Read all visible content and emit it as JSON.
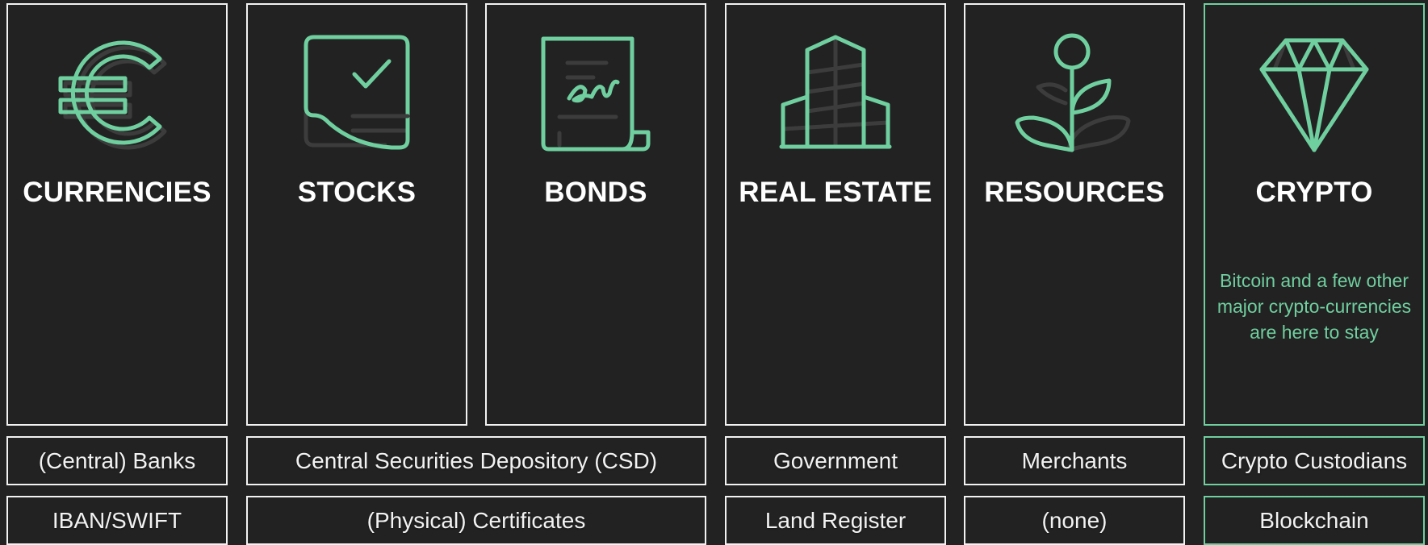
{
  "colors": {
    "background": "#222222",
    "border": "#f2f2f2",
    "accent": "#6fcf9f",
    "icon_shadow": "#3c3c3c"
  },
  "cards": [
    {
      "title": "CURRENCIES",
      "icon": "euro-icon"
    },
    {
      "title": "STOCKS",
      "icon": "stock-certificate-icon"
    },
    {
      "title": "BONDS",
      "icon": "signed-document-icon"
    },
    {
      "title": "REAL ESTATE",
      "icon": "building-icon"
    },
    {
      "title": "RESOURCES",
      "icon": "plant-icon"
    },
    {
      "title": "CRYPTO",
      "icon": "diamond-icon",
      "description": "Bitcoin and a few other major crypto-currencies are here to stay"
    }
  ],
  "custodians": {
    "currencies": "(Central) Banks",
    "stocks_bonds": "Central Securities Depository (CSD)",
    "real_estate": "Government",
    "resources": "Merchants",
    "crypto": "Crypto Custodians"
  },
  "records": {
    "currencies": "IBAN/SWIFT",
    "stocks_bonds": "(Physical) Certificates",
    "real_estate": "Land Register",
    "resources": "(none)",
    "crypto": "Blockchain"
  }
}
